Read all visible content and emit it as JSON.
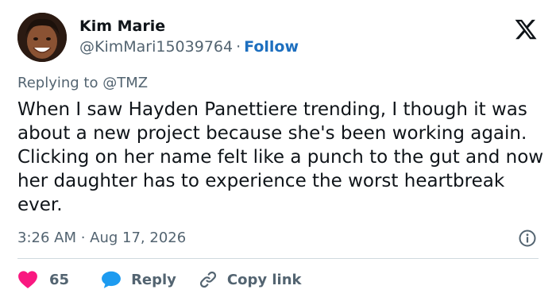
{
  "author": {
    "name": "Kim Marie",
    "handle": "@KimMari15039764",
    "separator": "·",
    "follow_label": "Follow"
  },
  "reply_context": "Replying to @TMZ",
  "tweet": {
    "text": "When I saw Hayden Panettiere trending, I though it was about a new project because she's been working again. Clicking on her name felt like a punch to the gut and now her daughter has to experience the worst heartbreak ever.",
    "timestamp": "3:26 AM · Aug 17, 2026"
  },
  "actions": {
    "like_count": "65",
    "reply_label": "Reply",
    "copy_link_label": "Copy link"
  },
  "icons": {
    "logo": "x-logo-icon",
    "info": "info-icon",
    "like": "heart-icon",
    "reply": "speech-bubble-icon",
    "copy": "link-icon"
  },
  "colors": {
    "follow": "#1d6fbf",
    "like": "#f91880",
    "reply": "#1d9bf0",
    "secondary_text": "#536471",
    "divider": "#cfd9de"
  }
}
